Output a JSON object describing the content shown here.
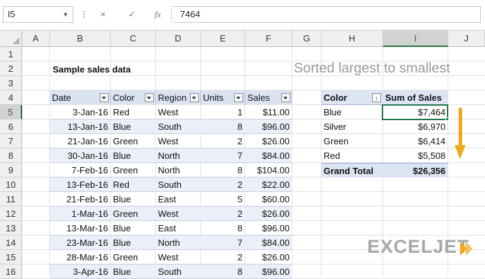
{
  "formula_bar": {
    "name_box": "I5",
    "cancel_icon": "×",
    "confirm_icon": "✓",
    "fx_label": "fx",
    "formula_value": "7464"
  },
  "columns": [
    "A",
    "B",
    "C",
    "D",
    "E",
    "F",
    "G",
    "H",
    "I",
    "J"
  ],
  "rows": [
    "1",
    "2",
    "3",
    "4",
    "5",
    "6",
    "7",
    "8",
    "9",
    "10",
    "11",
    "12",
    "13",
    "14",
    "15",
    "16"
  ],
  "sheet": {
    "title": "Sample sales data",
    "note": "Sorted largest to smallest"
  },
  "data_table": {
    "headers": [
      "Date",
      "Color",
      "Region",
      "Units",
      "Sales"
    ],
    "rows": [
      [
        "3-Jan-16",
        "Red",
        "West",
        "1",
        "$11.00"
      ],
      [
        "13-Jan-16",
        "Blue",
        "South",
        "8",
        "$96.00"
      ],
      [
        "21-Jan-16",
        "Green",
        "West",
        "2",
        "$26.00"
      ],
      [
        "30-Jan-16",
        "Blue",
        "North",
        "7",
        "$84.00"
      ],
      [
        "7-Feb-16",
        "Green",
        "North",
        "8",
        "$104.00"
      ],
      [
        "13-Feb-16",
        "Red",
        "South",
        "2",
        "$22.00"
      ],
      [
        "21-Feb-16",
        "Blue",
        "East",
        "5",
        "$60.00"
      ],
      [
        "1-Mar-16",
        "Green",
        "West",
        "2",
        "$26.00"
      ],
      [
        "13-Mar-16",
        "Blue",
        "East",
        "8",
        "$96.00"
      ],
      [
        "23-Mar-16",
        "Blue",
        "North",
        "7",
        "$84.00"
      ],
      [
        "28-Mar-16",
        "Green",
        "West",
        "2",
        "$26.00"
      ],
      [
        "3-Apr-16",
        "Blue",
        "South",
        "8",
        "$96.00"
      ]
    ]
  },
  "pivot": {
    "header_color": "Color",
    "header_sum": "Sum of Sales",
    "sort_indicator": "↓",
    "rows": [
      [
        "Blue",
        "$7,464"
      ],
      [
        "Silver",
        "$6,970"
      ],
      [
        "Green",
        "$6,414"
      ],
      [
        "Red",
        "$5,508"
      ]
    ],
    "total_label": "Grand Total",
    "total_value": "$26,356"
  },
  "logo": {
    "text": "EXCELJET"
  },
  "colors": {
    "accent": "#217346",
    "arrow": "#f0a81c",
    "table_header": "#dbe3f2",
    "table_band": "#eaeff8"
  }
}
